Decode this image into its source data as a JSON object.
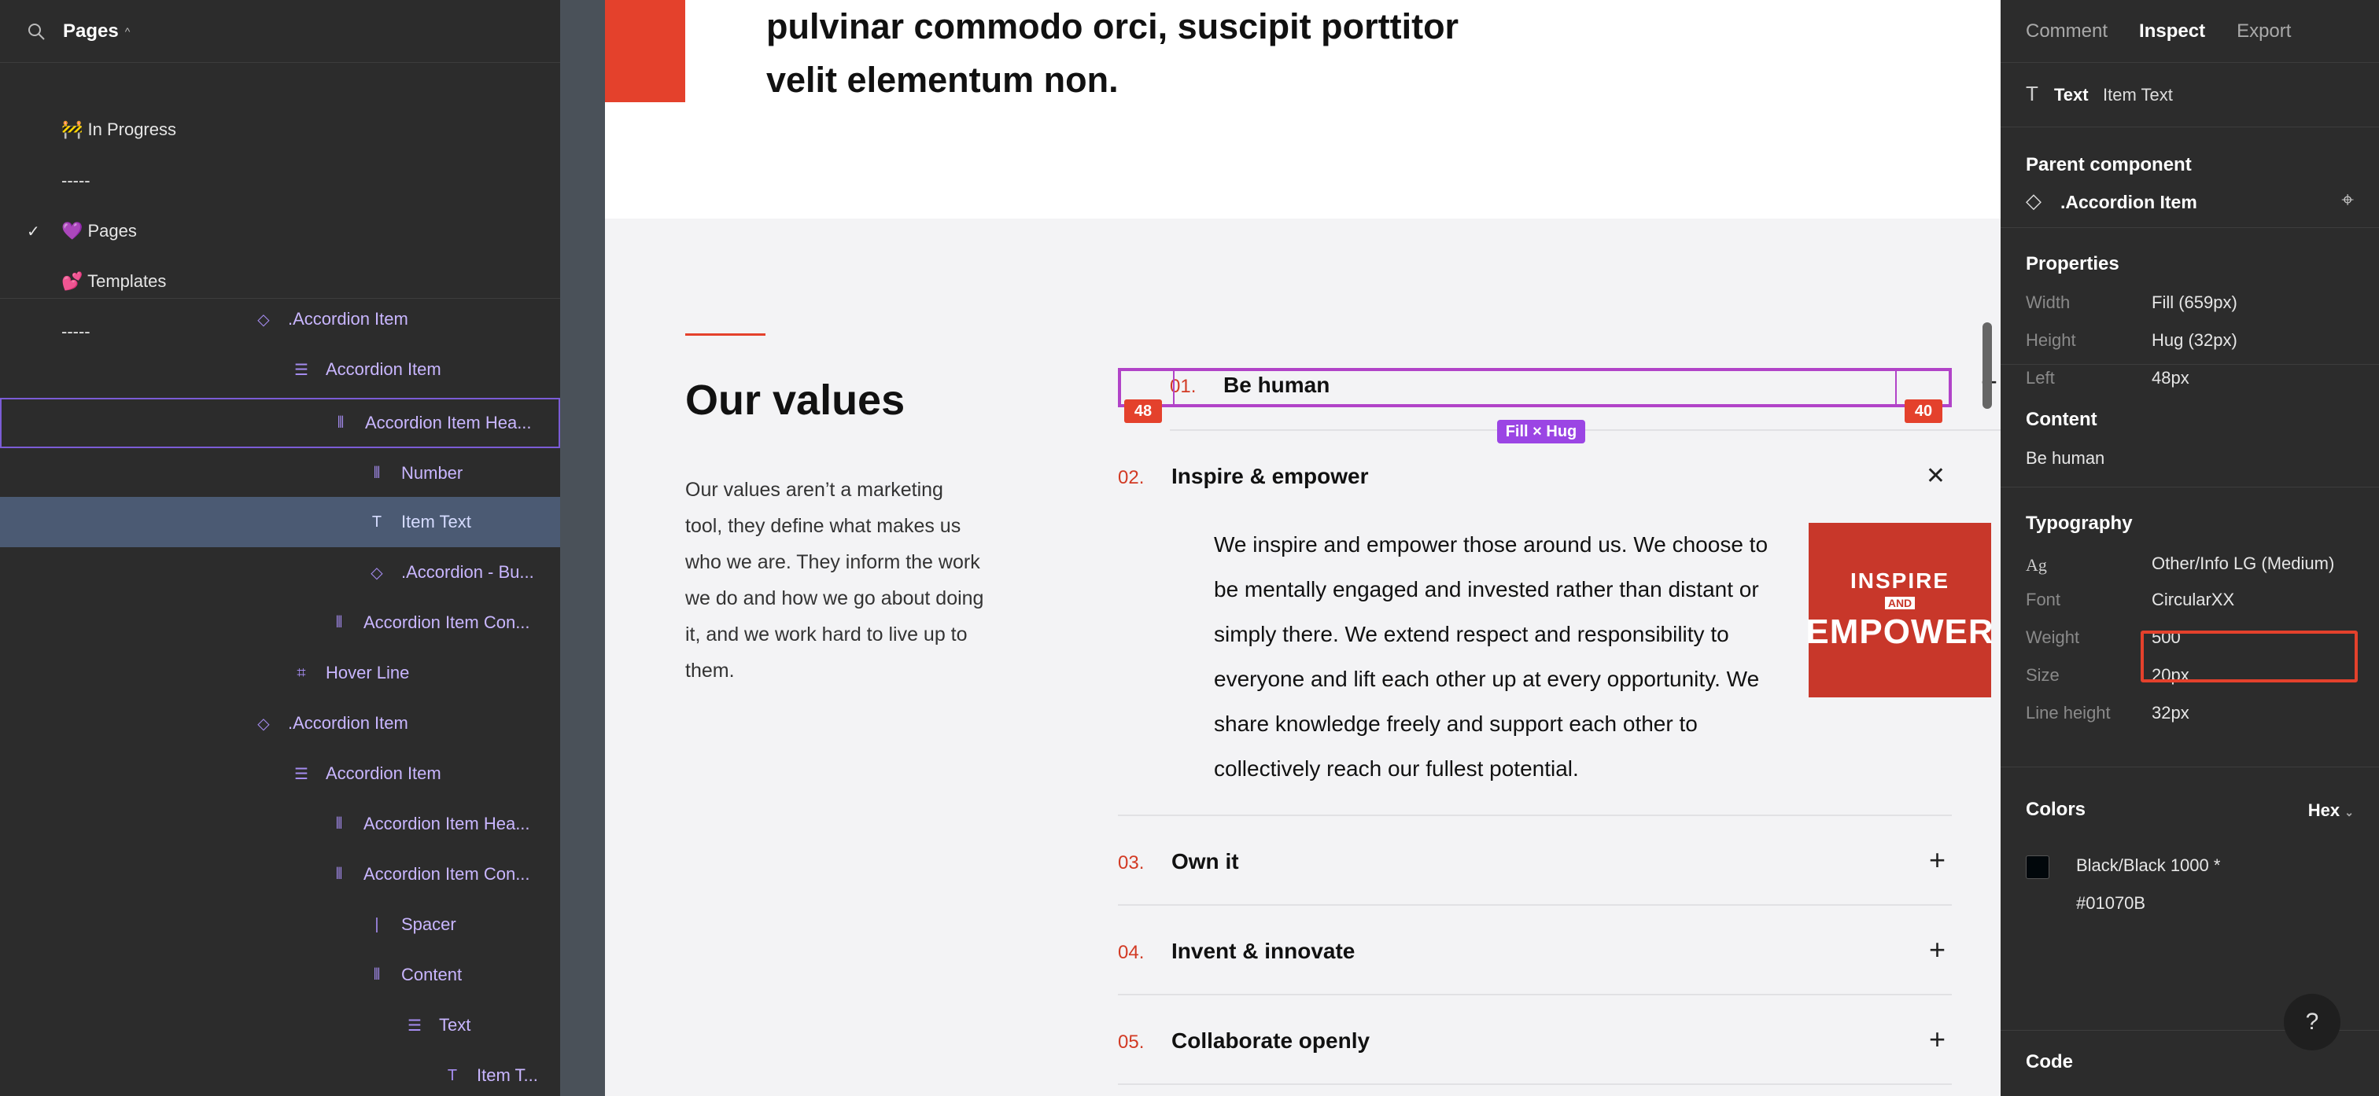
{
  "left_panel": {
    "header": {
      "title": "Pages",
      "chevron": "^"
    },
    "pages": [
      {
        "label": "🚧 In Progress",
        "checked": false
      },
      {
        "label": "-----",
        "checked": false
      },
      {
        "label": "💜 Pages",
        "checked": true
      },
      {
        "label": "💕 Templates",
        "checked": false
      },
      {
        "label": "-----",
        "checked": false
      }
    ],
    "layers": [
      {
        "label": ".Accordion Item",
        "icon": "component-icon",
        "indent": 0
      },
      {
        "label": "Accordion Item",
        "icon": "vertical-stack-icon",
        "indent": 1
      },
      {
        "label": "Accordion Item Hea...",
        "icon": "horizontal-stack-icon",
        "indent": 2
      },
      {
        "label": "Number",
        "icon": "horizontal-stack-icon",
        "indent": 3
      },
      {
        "label": "Item Text",
        "icon": "text-icon",
        "indent": 3
      },
      {
        "label": ".Accordion - Bu...",
        "icon": "instance-icon",
        "indent": 3
      },
      {
        "label": "Accordion Item Con...",
        "icon": "horizontal-stack-icon",
        "indent": 2
      },
      {
        "label": "Hover Line",
        "icon": "frame-icon",
        "indent": 1
      },
      {
        "label": ".Accordion Item",
        "icon": "component-icon",
        "indent": 0
      },
      {
        "label": "Accordion Item",
        "icon": "vertical-stack-icon",
        "indent": 1
      },
      {
        "label": "Accordion Item Hea...",
        "icon": "horizontal-stack-icon",
        "indent": 2
      },
      {
        "label": "Accordion Item Con...",
        "icon": "horizontal-stack-icon",
        "indent": 2
      },
      {
        "label": "Spacer",
        "icon": "spacer-icon",
        "indent": 3
      },
      {
        "label": "Content",
        "icon": "horizontal-stack-icon",
        "indent": 3
      },
      {
        "label": "Text",
        "icon": "vertical-stack-icon",
        "indent": 4
      },
      {
        "label": "Item T...",
        "icon": "text-icon",
        "indent": 5
      }
    ]
  },
  "canvas": {
    "quote": "pulvinar commodo orci, suscipit porttitor velit elementum non.",
    "values_title": "Our values",
    "values_desc": "Our values aren’t a marketing tool, they define what makes us who we are. They inform the work we do and how we go about doing it, and we work hard to live up to them.",
    "accordion": [
      {
        "num": "01.",
        "title": "Be human",
        "icon": "plus-icon"
      },
      {
        "num": "02.",
        "title": "Inspire & empower",
        "icon": "close-icon"
      },
      {
        "num": "03.",
        "title": "Own it",
        "icon": "plus-icon"
      },
      {
        "num": "04.",
        "title": "Invent & innovate",
        "icon": "plus-icon"
      },
      {
        "num": "05.",
        "title": "Collaborate openly",
        "icon": "plus-icon"
      }
    ],
    "expanded_body": "We inspire and empower those around us. We choose to be mentally engaged and invested rather than distant or simply there. We extend respect and responsibility to everyone and lift each other up at every opportunity. We share knowledge freely and support each other to collectively reach our fullest potential.",
    "image_text": {
      "line1": "INSPIRE",
      "line2": "AND",
      "line3": "EMPOWER"
    },
    "badges": {
      "left": "48",
      "right": "40",
      "fill_hug": "Fill × Hug"
    }
  },
  "right_panel": {
    "tabs": [
      "Comment",
      "Inspect",
      "Export"
    ],
    "active_tab": "Inspect",
    "layer_type": "Text",
    "layer_name": "Item Text",
    "parent_component_title": "Parent component",
    "parent_component": ".Accordion Item",
    "properties_title": "Properties",
    "properties": [
      {
        "k": "Width",
        "v": "Fill (659px)"
      },
      {
        "k": "Height",
        "v": "Hug (32px)"
      },
      {
        "k": "Left",
        "v": "48px"
      }
    ],
    "content_title": "Content",
    "content_value": "Be human",
    "typography_title": "Typography",
    "typography": [
      {
        "k": "Ag",
        "v": "Other/Info LG (Medium)"
      },
      {
        "k": "Font",
        "v": "CircularXX"
      },
      {
        "k": "Weight",
        "v": "500"
      },
      {
        "k": "Size",
        "v": "20px"
      },
      {
        "k": "Line height",
        "v": "32px"
      }
    ],
    "colors_title": "Colors",
    "colors_format": "Hex",
    "color_name": "Black/Black 1000 *",
    "color_hex": "#01070B",
    "swatch": "#01070B",
    "code_title": "Code",
    "help": "?"
  }
}
